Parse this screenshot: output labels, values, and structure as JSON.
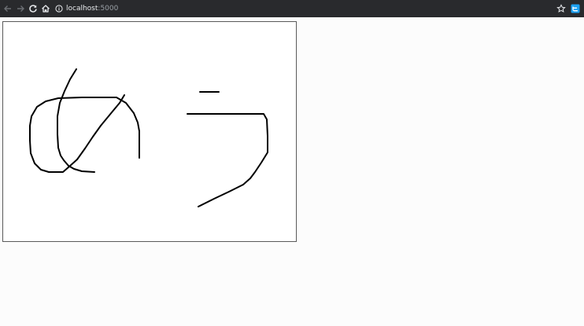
{
  "browser": {
    "url_host": "localhost",
    "url_port": ":5000"
  },
  "colors": {
    "toolbar_bg": "#292a2d",
    "extension_accent": "#1da1f2",
    "ink": "#000000"
  },
  "icons": {
    "back": "arrow-left",
    "forward": "arrow-right",
    "reload": "reload",
    "home": "home",
    "site_info": "info-circle",
    "bookmark": "star",
    "extension": "extension-badge"
  }
}
